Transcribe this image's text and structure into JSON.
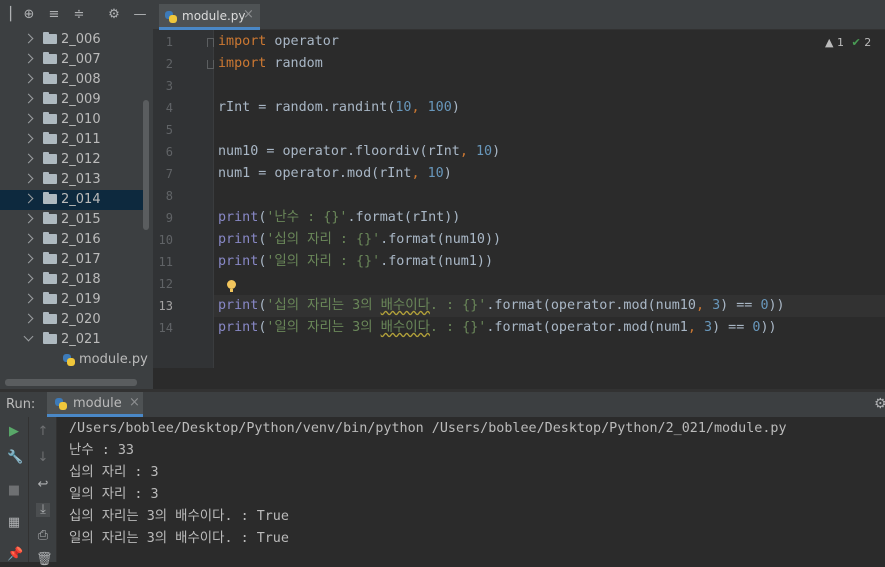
{
  "project_tree": {
    "items": [
      {
        "label": "2_006",
        "open": false,
        "selected": false
      },
      {
        "label": "2_007",
        "open": false,
        "selected": false
      },
      {
        "label": "2_008",
        "open": false,
        "selected": false
      },
      {
        "label": "2_009",
        "open": false,
        "selected": false
      },
      {
        "label": "2_010",
        "open": false,
        "selected": false
      },
      {
        "label": "2_011",
        "open": false,
        "selected": false
      },
      {
        "label": "2_012",
        "open": false,
        "selected": false
      },
      {
        "label": "2_013",
        "open": false,
        "selected": false
      },
      {
        "label": "2_014",
        "open": false,
        "selected": true
      },
      {
        "label": "2_015",
        "open": false,
        "selected": false
      },
      {
        "label": "2_016",
        "open": false,
        "selected": false
      },
      {
        "label": "2_017",
        "open": false,
        "selected": false
      },
      {
        "label": "2_018",
        "open": false,
        "selected": false
      },
      {
        "label": "2_019",
        "open": false,
        "selected": false
      },
      {
        "label": "2_020",
        "open": false,
        "selected": false
      },
      {
        "label": "2_021",
        "open": true,
        "selected": false
      }
    ],
    "child_file": "module.py"
  },
  "editor": {
    "tab_label": "module.py",
    "inspections": {
      "warnings": "1",
      "ok": "2"
    },
    "current_line": "13",
    "line_numbers": [
      "1",
      "2",
      "3",
      "4",
      "5",
      "6",
      "7",
      "8",
      "9",
      "10",
      "11",
      "12",
      "13",
      "14"
    ]
  },
  "run": {
    "label": "Run:",
    "tab_label": "module",
    "output": [
      "/Users/boblee/Desktop/Python/venv/bin/python /Users/boblee/Desktop/Python/2_021/module.py",
      "난수 : 33",
      "십의 자리 : 3",
      "일의 자리 : 3",
      "십의 자리는 3의 배수이다. : True",
      "일의 자리는 3의 배수이다. : True"
    ]
  },
  "colors": {
    "keyword": "#cc7832",
    "number": "#6897bb",
    "string": "#6a8759",
    "builtin": "#8888c6",
    "selection": "#0d293e",
    "accent": "#4a88c7"
  }
}
